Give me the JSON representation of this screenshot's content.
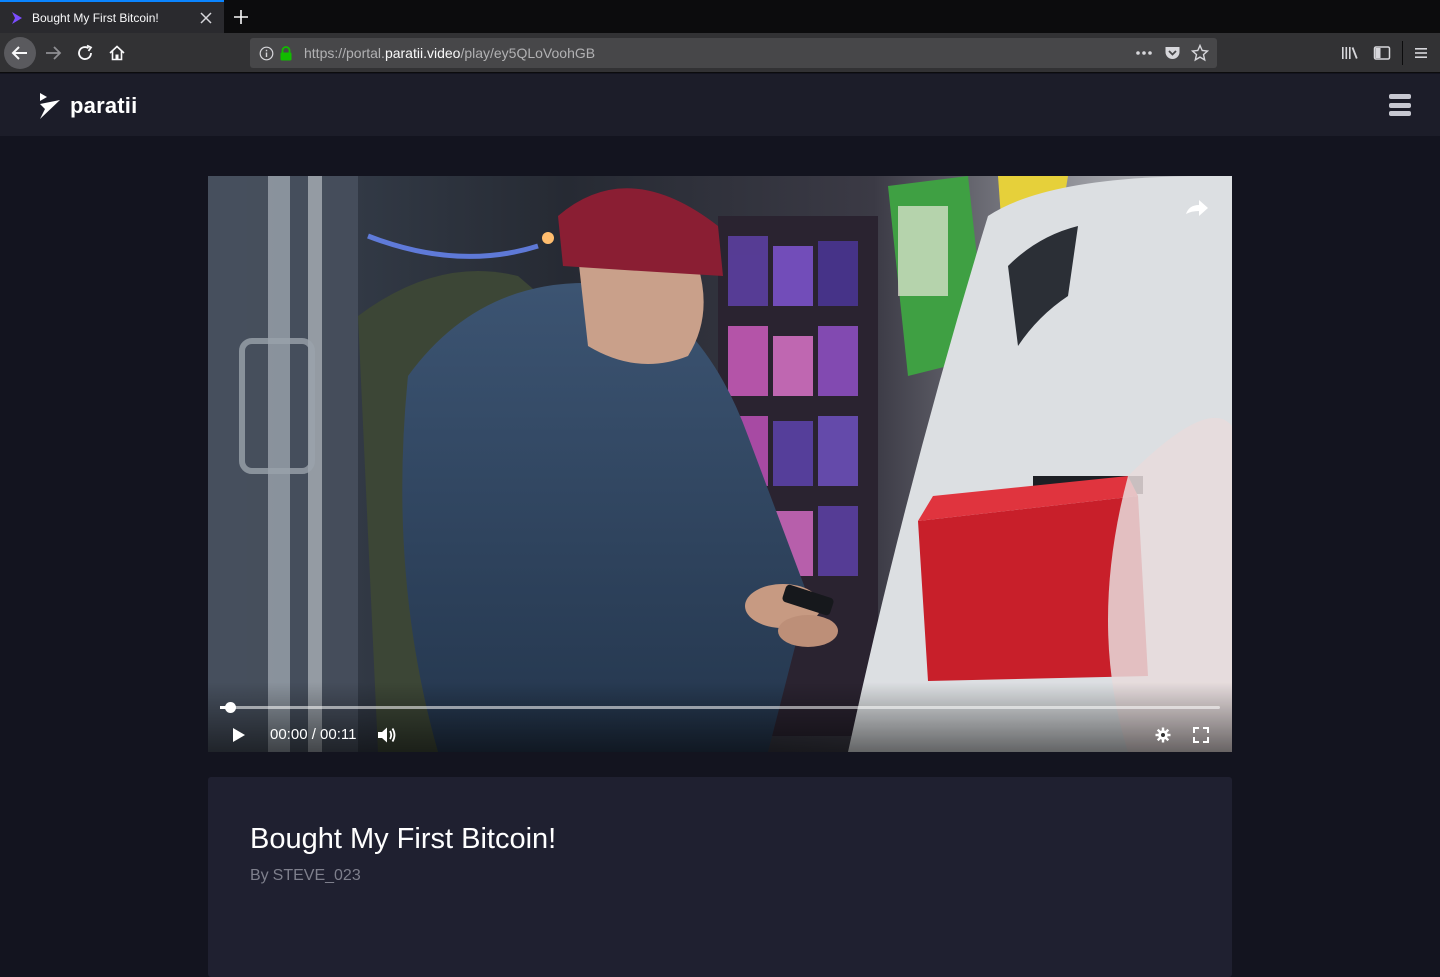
{
  "browser": {
    "tab_title": "Bought My First Bitcoin!",
    "url_prefix": "https://portal.",
    "url_host": "paratii.video",
    "url_path": "/play/ey5QLoVoohGB"
  },
  "app": {
    "logo_text": "paratii",
    "accent_color": "#5a3fe0"
  },
  "player": {
    "time_display": "00:00 / 00:11",
    "progress_fraction": 0.01
  },
  "video": {
    "title": "Bought My First Bitcoin!",
    "author_prefix": "By",
    "author": "STEVE_023"
  }
}
